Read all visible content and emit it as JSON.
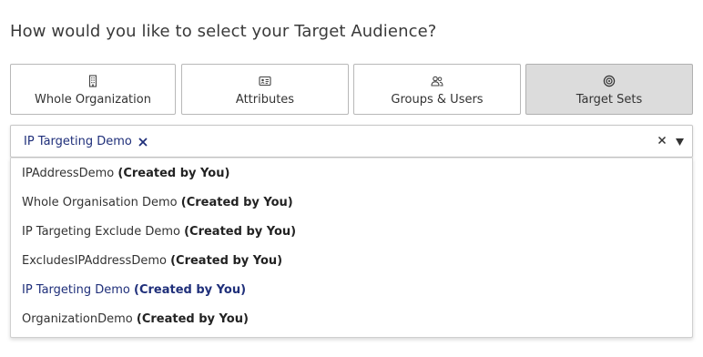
{
  "question": "How would you like to select your Target Audience?",
  "options": [
    {
      "label": "Whole Organization",
      "icon": "building-icon",
      "selected": false
    },
    {
      "label": "Attributes",
      "icon": "id-card-icon",
      "selected": false
    },
    {
      "label": "Groups & Users",
      "icon": "users-icon",
      "selected": false
    },
    {
      "label": "Target Sets",
      "icon": "target-icon",
      "selected": true
    }
  ],
  "select": {
    "chip_label": "IP Targeting Demo",
    "chip_remove_icon": "close-icon",
    "clear_icon": "close-icon",
    "dropdown_icon": "caret-down-icon"
  },
  "menu": {
    "items": [
      {
        "name": "IPAddressDemo",
        "owner": "(Created by You)",
        "active": false
      },
      {
        "name": "Whole Organisation Demo",
        "owner": "(Created by You)",
        "active": false
      },
      {
        "name": "IP Targeting Exclude Demo",
        "owner": "(Created by You)",
        "active": false
      },
      {
        "name": "ExcludesIPAddressDemo",
        "owner": "(Created by You)",
        "active": false
      },
      {
        "name": "IP Targeting Demo",
        "owner": "(Created by You)",
        "active": true
      },
      {
        "name": "OrganizationDemo",
        "owner": "(Created by You)",
        "active": false
      }
    ]
  },
  "colors": {
    "accent": "#1f2f7a",
    "selected_bg": "#dcdcdc",
    "border": "#b8b8b8"
  }
}
